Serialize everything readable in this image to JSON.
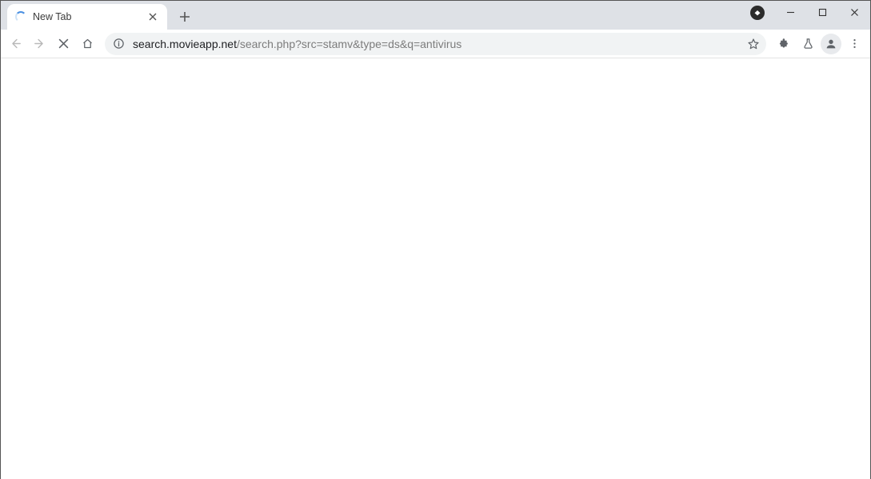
{
  "window": {
    "minimize_tooltip": "Minimize",
    "maximize_tooltip": "Maximize",
    "close_tooltip": "Close"
  },
  "tabs": {
    "active": {
      "title": "New Tab",
      "loading": true
    },
    "new_tab_tooltip": "New tab",
    "close_tab_tooltip": "Close"
  },
  "toolbar": {
    "back_tooltip": "Back",
    "forward_tooltip": "Forward",
    "stop_tooltip": "Stop",
    "home_tooltip": "Home",
    "bookmark_tooltip": "Bookmark this tab",
    "extensions_tooltip": "Extensions",
    "labs_tooltip": "Experiments",
    "profile_tooltip": "You",
    "menu_tooltip": "Customize and control"
  },
  "omnibox": {
    "site_info_tooltip": "View site information",
    "host": "search.movieapp.net",
    "path": "/search.php?src=stamv&type=ds&q=antivirus"
  },
  "badge": {
    "tooltip": "Security extension"
  }
}
